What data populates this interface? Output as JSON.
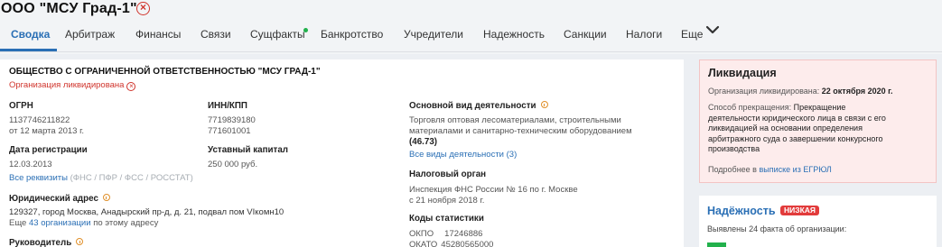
{
  "header": {
    "company_title": "ООО \"МСУ Град-1\"",
    "close_icon": "close-circle-icon",
    "tabs": [
      {
        "label": "Сводка",
        "active": true
      },
      {
        "label": "Арбитраж"
      },
      {
        "label": "Финансы"
      },
      {
        "label": "Связи"
      },
      {
        "label": "Сущфакты",
        "indicator": "green-dot"
      },
      {
        "label": "Банкротство"
      },
      {
        "label": "Учредители"
      },
      {
        "label": "Надежность"
      },
      {
        "label": "Санкции"
      },
      {
        "label": "Налоги"
      },
      {
        "label": "Еще",
        "icon": "chevron-down-icon"
      }
    ]
  },
  "main": {
    "full_name": "ОБЩЕСТВО С ОГРАНИЧЕННОЙ ОТВЕТСТВЕННОСТЬЮ \"МСУ ГРАД-1\"",
    "status": "Организация ликвидирована",
    "ogrn": {
      "label": "ОГРН",
      "value": "1137746211822",
      "date": "от 12 марта 2013 г."
    },
    "inn_kpp": {
      "label": "ИНН/КПП",
      "inn": "7719839180",
      "kpp": "771601001"
    },
    "reg_date": {
      "label": "Дата регистрации",
      "value": "12.03.2013"
    },
    "capital": {
      "label": "Уставный капитал",
      "value": "250 000 руб."
    },
    "requisites": {
      "link": "Все реквизиты",
      "sources": "(ФНС / ПФР / ФСС / РОССТАТ)"
    },
    "address": {
      "label": "Юридический адрес",
      "value": "129327, город Москва, Анадырский пр-д, д. 21, подвал пом VIкомн10",
      "more_prefix": "Еще",
      "more_link": "43 организации",
      "more_suffix": "по этому адресу"
    },
    "director_label": "Руководитель",
    "activity": {
      "label": "Основной вид деятельности",
      "line1": "Торговля оптовая лесоматериалами, строительными",
      "line2": "материалами и санитарно-техническим оборудованием",
      "code": "(46.73)",
      "all_link": "Все виды деятельности (3)"
    },
    "tax_authority": {
      "label": "Налоговый орган",
      "line1": "Инспекция ФНС России № 16 по г. Москве",
      "line2": "с 21 ноября 2018 г."
    },
    "stat_codes": {
      "label": "Коды статистики",
      "okpo_label": "ОКПО",
      "okpo_value": "17246886",
      "okato_label": "ОКАТО",
      "okato_value": "45280565000"
    }
  },
  "liquidation": {
    "title": "Ликвидация",
    "date_label": "Организация ликвидирована:",
    "date_value": "22 октября 2020 г.",
    "method_label": "Способ прекращения:",
    "method_text_1": "Прекращение",
    "method_text_2": "деятельности юридического лица в связи с его",
    "method_text_3": "ликвидацией на основании определения",
    "method_text_4": "арбитражного суда о завершении конкурсного",
    "method_text_5": "производства",
    "details_prefix": "Подробнее в",
    "details_link": "выписке из ЕГРЮЛ"
  },
  "reliability": {
    "title": "Надёжность",
    "badge": "НИЗКАЯ",
    "badge_color": "#e23b3b",
    "facts": "Выявлены 24 факта об организации:",
    "fact_color": "#22b14c"
  }
}
